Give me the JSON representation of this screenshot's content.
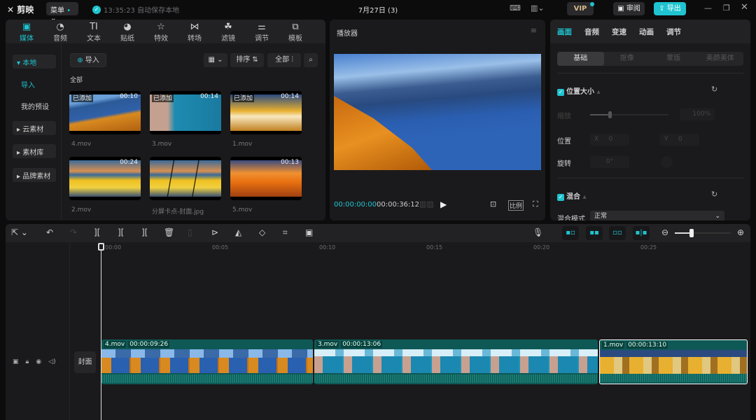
{
  "app": {
    "name": "剪映",
    "menu": "菜单",
    "autosave": "13:35:23 自动保存本地",
    "title": "7月27日 (3)",
    "vip": "VIP",
    "review": "审阅",
    "export": "导出",
    "accent": "#1fc4d0"
  },
  "media_tabs": [
    {
      "label": "媒体",
      "icon": "media-icon"
    },
    {
      "label": "音频",
      "icon": "audio-icon"
    },
    {
      "label": "文本",
      "icon": "TI"
    },
    {
      "label": "贴纸",
      "icon": "sticker-icon"
    },
    {
      "label": "特效",
      "icon": "effects-icon"
    },
    {
      "label": "转场",
      "icon": "transition-icon"
    },
    {
      "label": "滤镜",
      "icon": "filter-icon"
    },
    {
      "label": "调节",
      "icon": "adjust-icon"
    },
    {
      "label": "模板",
      "icon": "template-icon"
    }
  ],
  "sidebar": {
    "local": "本地",
    "import": "导入",
    "presets": "我的预设",
    "cloud": "云素材",
    "library": "素材库",
    "brand": "品牌素材"
  },
  "media": {
    "import": "导入",
    "sort": "排序",
    "all_filter": "全部",
    "section": "全部",
    "items": [
      {
        "name": "4.mov",
        "duration": "00:10",
        "badge": "已添加"
      },
      {
        "name": "3.mov",
        "duration": "00:14",
        "badge": "已添加"
      },
      {
        "name": "1.mov",
        "duration": "00:14",
        "badge": "已添加"
      },
      {
        "name": "2.mov",
        "duration": "00:24",
        "badge": ""
      },
      {
        "name": "分屏卡点-封面.jpg",
        "duration": "",
        "badge": ""
      },
      {
        "name": "5.mov",
        "duration": "00:13",
        "badge": ""
      }
    ]
  },
  "player": {
    "title": "播放器",
    "current": "00:00:00:00",
    "total": "00:00:36:12",
    "ratio": "比例"
  },
  "inspector": {
    "tabs": [
      "画面",
      "音频",
      "变速",
      "动画",
      "调节"
    ],
    "subtabs": [
      "基础",
      "抠像",
      "蒙版",
      "美颜美体"
    ],
    "position_size": "位置大小",
    "scale_label": "缩放",
    "scale_value": "100%",
    "scale_level": 0.25,
    "position_label": "位置",
    "x_label": "X",
    "x_value": "0",
    "y_label": "Y",
    "y_value": "0",
    "rotate_label": "旋转",
    "rotate_value": "0°",
    "blend": "混合",
    "blend_mode_label": "混合模式",
    "blend_mode_value": "正常"
  },
  "timeline": {
    "ruler": [
      "00:00",
      "00:05",
      "00:10",
      "00:15",
      "00:20",
      "00:25"
    ],
    "cover": "封面",
    "zoom_level": 0.3,
    "clips": [
      {
        "name": "4.mov",
        "duration": "00:00:09:26"
      },
      {
        "name": "3.mov",
        "duration": "00:00:13:06"
      },
      {
        "name": "1.mov",
        "duration": "00:00:13:10"
      }
    ]
  }
}
